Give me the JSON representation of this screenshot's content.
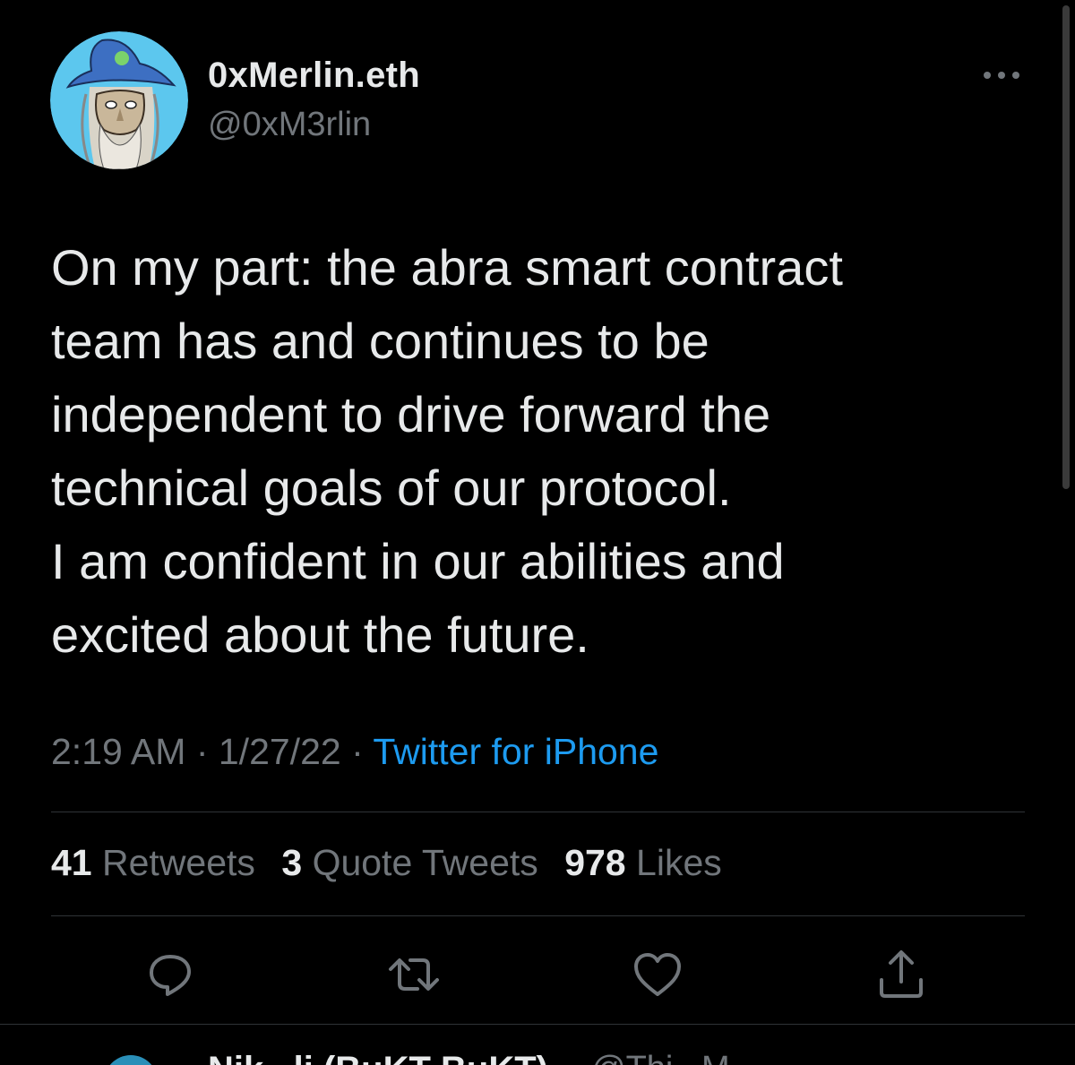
{
  "author": {
    "display_name": "0xMerlin.eth",
    "handle": "@0xM3rlin"
  },
  "tweet": {
    "text": "On my part: the abra smart contract\nteam has and continues to be\nindependent to drive forward the\ntechnical goals of our protocol.\nI am confident in our abilities and\nexcited about the future.",
    "time": "2:19 AM",
    "separator": " · ",
    "date": "1/27/22",
    "source": "Twitter for iPhone"
  },
  "stats": {
    "retweets_count": "41",
    "retweets_label": "Retweets",
    "quotes_count": "3",
    "quotes_label": "Quote Tweets",
    "likes_count": "978",
    "likes_label": "Likes"
  },
  "actions": {
    "icons": [
      "reply-icon",
      "retweet-icon",
      "like-icon",
      "share-icon"
    ],
    "icon_color": "#71767b"
  },
  "next_reply": {
    "display_name": "Nik...li (BuKT BuKT)",
    "handle": "@Thi...M..."
  },
  "colors": {
    "background": "#000000",
    "primary_text": "#e7e9ea",
    "secondary_text": "#71767b",
    "link": "#1d9bf0",
    "divider": "#2f3336"
  }
}
